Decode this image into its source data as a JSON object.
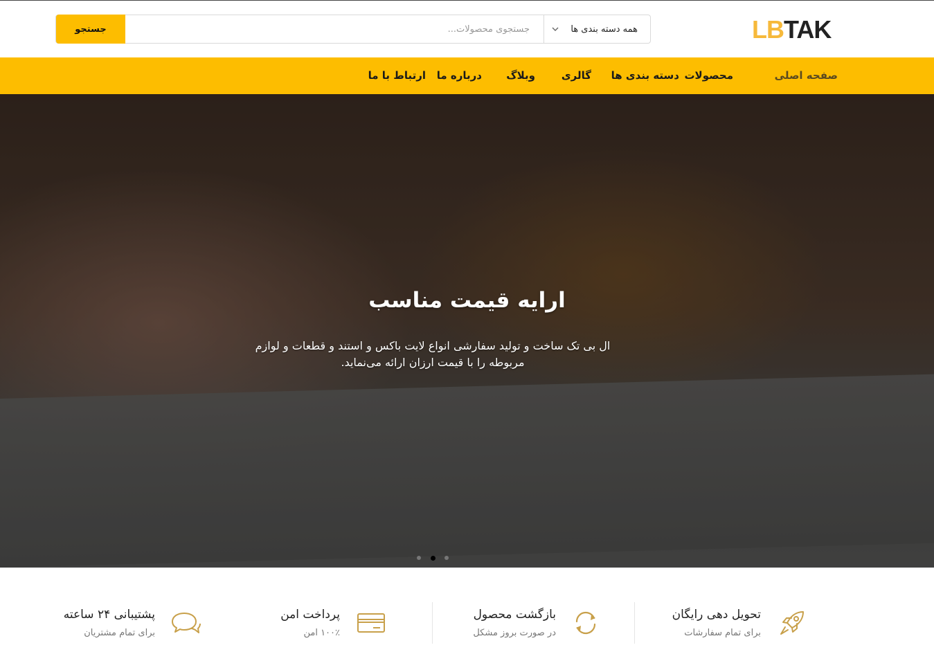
{
  "brand": {
    "logo_part1": "LB",
    "logo_part2": "TAK"
  },
  "search": {
    "button_label": "جستجو",
    "placeholder": "جستجوی محصولات...",
    "value": "",
    "category_selected": "همه دسته بندی ها"
  },
  "nav": {
    "items": [
      {
        "label": "صفحه اصلی",
        "active": true
      },
      {
        "label": "محصولات"
      },
      {
        "label": "دسته بندی ها"
      },
      {
        "label": "گالری"
      },
      {
        "label": "وبلاگ"
      },
      {
        "label": "درباره ما"
      },
      {
        "label": "ارتباط با ما"
      }
    ]
  },
  "hero": {
    "title": "ارایه قیمت مناسب",
    "text": "ال بی تک ساخت و تولید سفارشی انواع لایت باکس و استند و قطعات و لوازم مربوطه را با قیمت ارزان ارائه می‌نماید.",
    "slide_count": 3,
    "active_slide": 2
  },
  "features": [
    {
      "title": "تحویل دهی رایگان",
      "subtitle": "برای تمام سفارشات",
      "icon": "rocket-icon"
    },
    {
      "title": "بازگشت محصول",
      "subtitle": "در صورت بروز مشکل",
      "icon": "refresh-icon"
    },
    {
      "title": "پرداخت امن",
      "subtitle": "۱۰۰٪ امن",
      "icon": "credit-card-icon"
    },
    {
      "title": "پشتیبانی ۲۴ ساعته",
      "subtitle": "برای تمام مشتریان",
      "icon": "chat-bubbles-icon"
    }
  ],
  "colors": {
    "accent": "#fdbd00",
    "logo_accent": "#f6b93b",
    "icon_gold": "#c8a04a"
  }
}
